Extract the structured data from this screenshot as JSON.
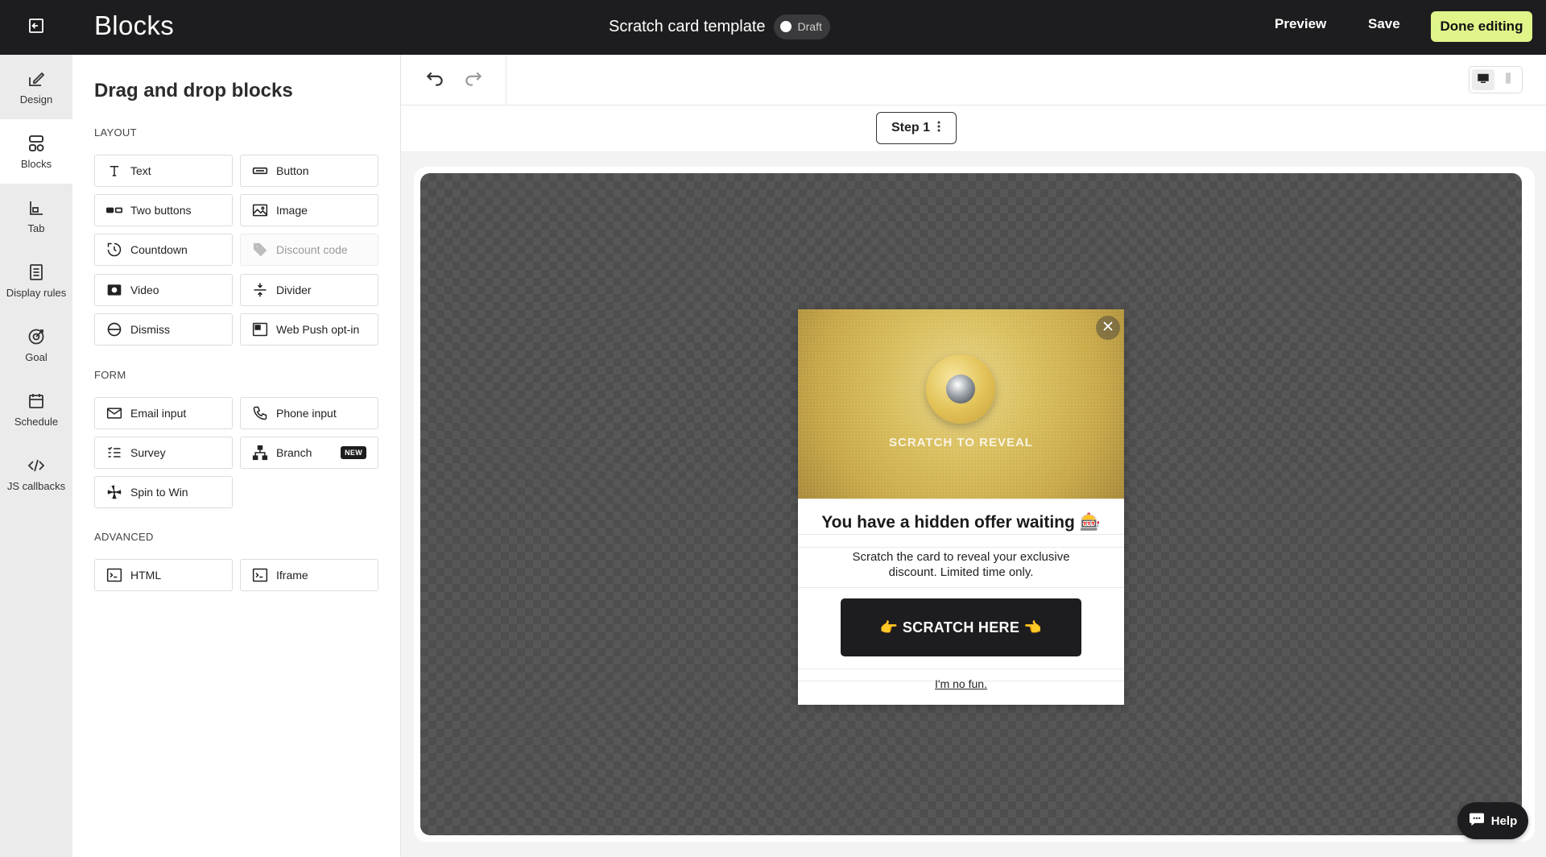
{
  "header": {
    "title": "Blocks",
    "template_name": "Scratch card template",
    "status": "Draft",
    "preview_label": "Preview",
    "save_label": "Save",
    "done_label": "Done editing",
    "accent_color": "#dff58a",
    "exit_icon": "exit-icon"
  },
  "rail": {
    "items": [
      {
        "label": "Design",
        "icon": "design-icon"
      },
      {
        "label": "Blocks",
        "icon": "blocks-icon",
        "active": true
      },
      {
        "label": "Tab",
        "icon": "tab-icon"
      },
      {
        "label": "Display rules",
        "icon": "display-rules-icon"
      },
      {
        "label": "Goal",
        "icon": "goal-icon"
      },
      {
        "label": "Schedule",
        "icon": "schedule-icon"
      },
      {
        "label": "JS callbacks",
        "icon": "code-icon"
      }
    ]
  },
  "panel": {
    "title": "Drag and drop blocks",
    "sections": [
      {
        "label": "LAYOUT",
        "blocks": [
          {
            "label": "Text",
            "icon": "text-icon"
          },
          {
            "label": "Button",
            "icon": "button-icon"
          },
          {
            "label": "Two buttons",
            "icon": "two-buttons-icon"
          },
          {
            "label": "Image",
            "icon": "image-icon"
          },
          {
            "label": "Countdown",
            "icon": "countdown-icon"
          },
          {
            "label": "Discount code",
            "icon": "tag-icon",
            "disabled": true
          },
          {
            "label": "Video",
            "icon": "video-icon"
          },
          {
            "label": "Divider",
            "icon": "divider-icon"
          },
          {
            "label": "Dismiss",
            "icon": "dismiss-icon"
          },
          {
            "label": "Web Push opt-in",
            "icon": "web-push-icon"
          }
        ]
      },
      {
        "label": "FORM",
        "blocks": [
          {
            "label": "Email input",
            "icon": "email-icon"
          },
          {
            "label": "Phone input",
            "icon": "phone-icon"
          },
          {
            "label": "Survey",
            "icon": "survey-icon"
          },
          {
            "label": "Branch",
            "icon": "branch-icon",
            "badge": "NEW"
          },
          {
            "label": "Spin to Win",
            "icon": "spin-wheel-icon"
          }
        ]
      },
      {
        "label": "ADVANCED",
        "blocks": [
          {
            "label": "HTML",
            "icon": "html-icon"
          },
          {
            "label": "Iframe",
            "icon": "iframe-icon"
          }
        ]
      }
    ]
  },
  "toolbar": {
    "undo_icon": "undo-icon",
    "redo_icon": "redo-icon",
    "device": "desktop"
  },
  "step": {
    "label": "Step 1",
    "menu_icon": "more-vertical-icon"
  },
  "popup": {
    "scratch_text": "SCRATCH TO REVEAL",
    "headline": "You have a hidden offer waiting 🎰",
    "body": "Scratch the card to reveal your exclusive discount. Limited time only.",
    "cta_label": "👉 SCRATCH HERE 👈",
    "dismiss_label": "I'm no fun.",
    "close_icon": "close-icon"
  },
  "help": {
    "label": "Help",
    "icon": "chat-icon"
  }
}
